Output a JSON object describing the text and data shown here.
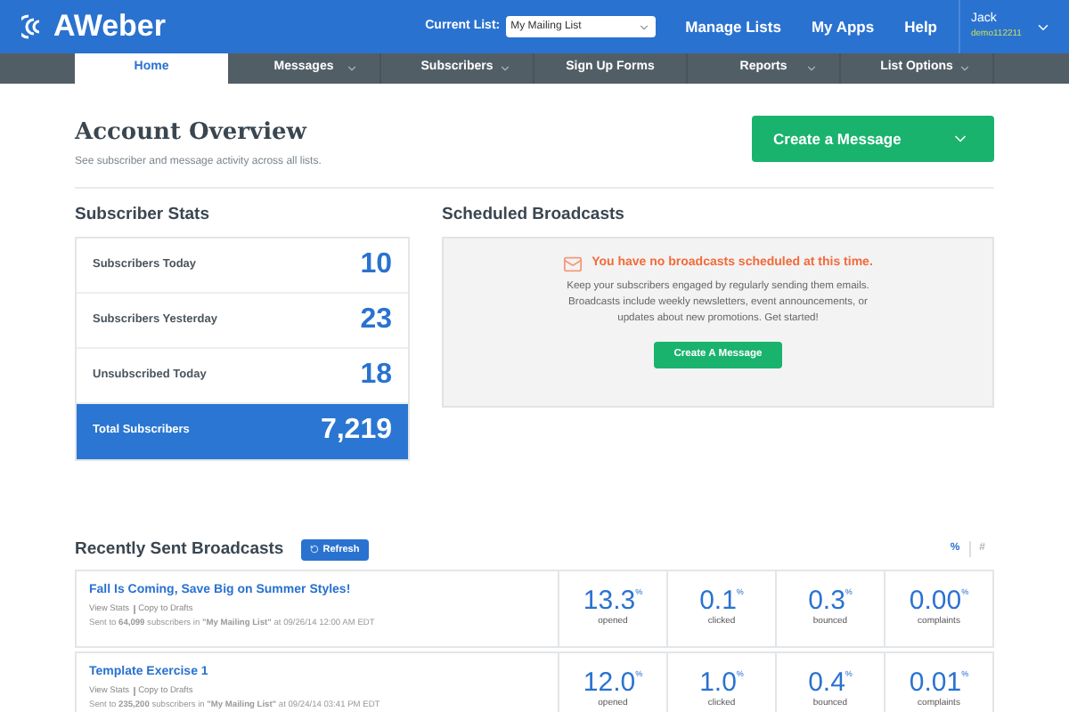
{
  "header": {
    "logo": "AWeber",
    "current_list_label": "Current List:",
    "current_list_value": "My Mailing List",
    "links": [
      "Manage Lists",
      "My Apps",
      "Help"
    ],
    "user": {
      "name": "Jack",
      "account": "demo112211"
    }
  },
  "nav": [
    {
      "label": "Home",
      "selected": true,
      "dropdown": false
    },
    {
      "label": "Messages",
      "selected": false,
      "dropdown": true
    },
    {
      "label": "Subscribers",
      "selected": false,
      "dropdown": true
    },
    {
      "label": "Sign Up Forms",
      "selected": false,
      "dropdown": false
    },
    {
      "label": "Reports",
      "selected": false,
      "dropdown": true
    },
    {
      "label": "List Options",
      "selected": false,
      "dropdown": true
    }
  ],
  "overview": {
    "title": "Account Overview",
    "subtitle": "See subscriber and message activity across all lists.",
    "create_button": "Create a Message"
  },
  "subscriber_stats": {
    "title": "Subscriber Stats",
    "rows": [
      {
        "label": "Subscribers Today",
        "value": "10",
        "total": false
      },
      {
        "label": "Subscribers Yesterday",
        "value": "23",
        "total": false
      },
      {
        "label": "Unsubscribed Today",
        "value": "18",
        "total": false
      },
      {
        "label": "Total Subscribers",
        "value": "7,219",
        "total": true
      }
    ]
  },
  "scheduled": {
    "title": "Scheduled Broadcasts",
    "notice": "You have no broadcasts scheduled at this time.",
    "text": "Keep your subscribers engaged by regularly sending them emails. Broadcasts include weekly newsletters, event announcements, or updates about new promotions. Get started!",
    "button": "Create A Message"
  },
  "recent": {
    "title": "Recently Sent Broadcasts",
    "refresh": "Refresh",
    "toggle": [
      {
        "label": "%",
        "selected": true
      },
      {
        "label": "#",
        "selected": false
      }
    ],
    "broadcasts": [
      {
        "subject": "Fall Is Coming, Save Big on Summer Styles!",
        "actions": [
          "View Stats",
          "Copy to Drafts"
        ],
        "meta": "Sent to **64,099** subscribers in **\"My Mailing List\"** at 09/26/14 12:00 AM EDT",
        "metrics": [
          {
            "value": "13.3",
            "unit": "%",
            "label": "opened"
          },
          {
            "value": "0.1",
            "unit": "%",
            "label": "clicked"
          },
          {
            "value": "0.3",
            "unit": "%",
            "label": "bounced"
          },
          {
            "value": "0.00",
            "unit": "%",
            "label": "complaints"
          }
        ]
      },
      {
        "subject": "Template Exercise 1",
        "actions": [
          "View Stats",
          "Copy to Drafts"
        ],
        "meta": "Sent to **235,200** subscribers in **\"My Mailing List\"** at 09/24/14 03:41 PM EDT",
        "metrics": [
          {
            "value": "12.0",
            "unit": "%",
            "label": "opened"
          },
          {
            "value": "1.0",
            "unit": "%",
            "label": "clicked"
          },
          {
            "value": "0.4",
            "unit": "%",
            "label": "bounced"
          },
          {
            "value": "0.01",
            "unit": "%",
            "label": "complaints"
          }
        ]
      }
    ]
  }
}
